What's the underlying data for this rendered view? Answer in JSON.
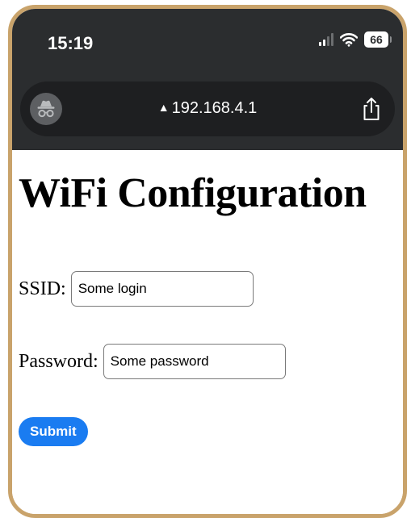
{
  "status_bar": {
    "time": "15:19",
    "battery": "66"
  },
  "browser": {
    "url": "192.168.4.1"
  },
  "page": {
    "title": "WiFi Configuration",
    "ssid_label": "SSID:",
    "ssid_value": "Some login",
    "password_label": "Password:",
    "password_value": "Some password",
    "submit_label": "Submit"
  },
  "icons": {
    "incognito": "incognito-icon",
    "share": "share-icon",
    "warning": "warning-icon",
    "signal": "signal-icon",
    "wifi": "wifi-icon",
    "battery": "battery-icon"
  },
  "colors": {
    "frame": "#c9a36b",
    "browser_chrome": "#2b2d2f",
    "submit": "#1a7cf1"
  }
}
